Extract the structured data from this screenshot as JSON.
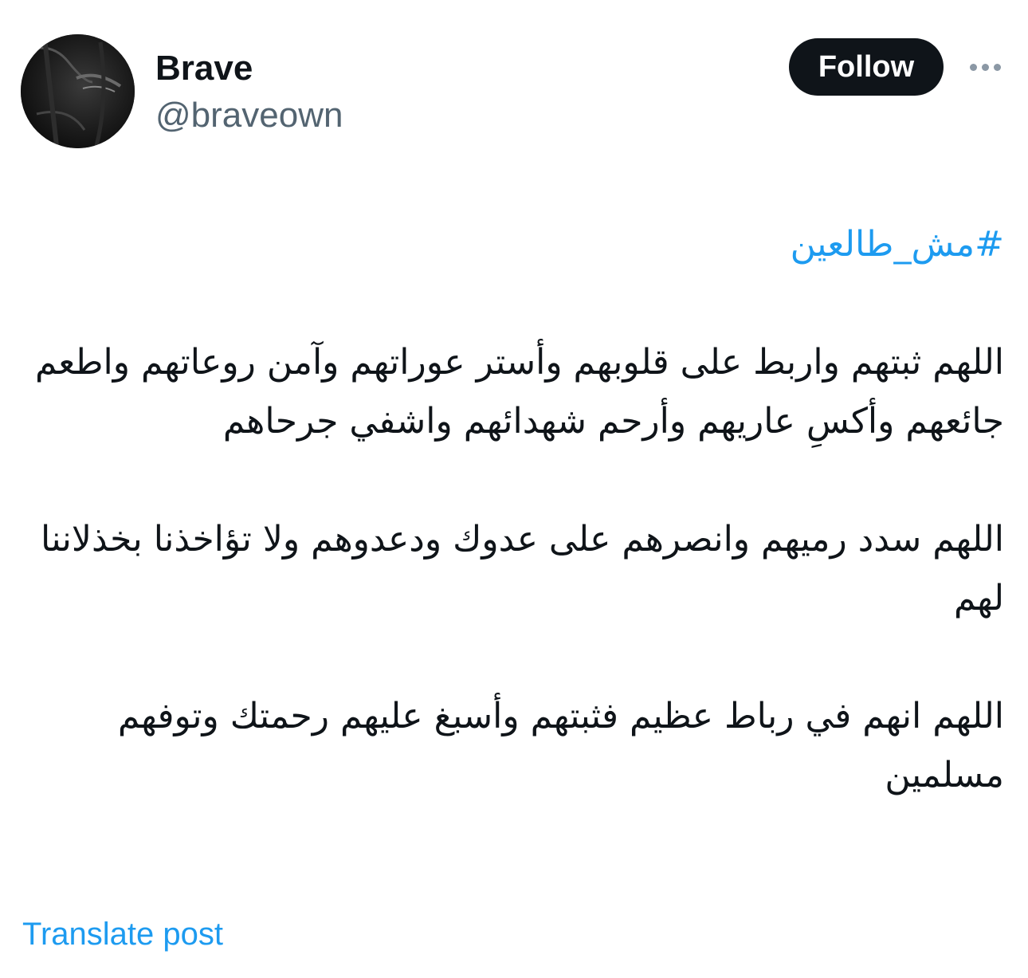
{
  "author": {
    "display_name": "Brave",
    "handle": "@braveown",
    "avatar_icon": "profile-avatar"
  },
  "actions": {
    "follow_label": "Follow",
    "more_icon": "more-horizontal-icon"
  },
  "tweet": {
    "hashtag": "#مش_طالعين",
    "paragraphs": [
      "اللهم ثبتهم واربط على قلوبهم وأستر عوراتهم وآمن روعاتهم واطعم جائعهم وأكسِ عاريهم وأرحم شهدائهم واشفي جرحاهم",
      "اللهم سدد رميهم وانصرهم على عدوك ودعدوهم ولا تؤاخذنا بخذلاننا لهم",
      "اللهم انهم في رباط عظيم فثبتهم وأسبغ عليهم رحمتك وتوفهم مسلمين"
    ]
  },
  "footer": {
    "translate_label": "Translate post"
  },
  "colors": {
    "text_primary": "#0f1419",
    "text_secondary": "#536471",
    "link_blue": "#1d9bf0",
    "button_dark": "#0f1419"
  }
}
